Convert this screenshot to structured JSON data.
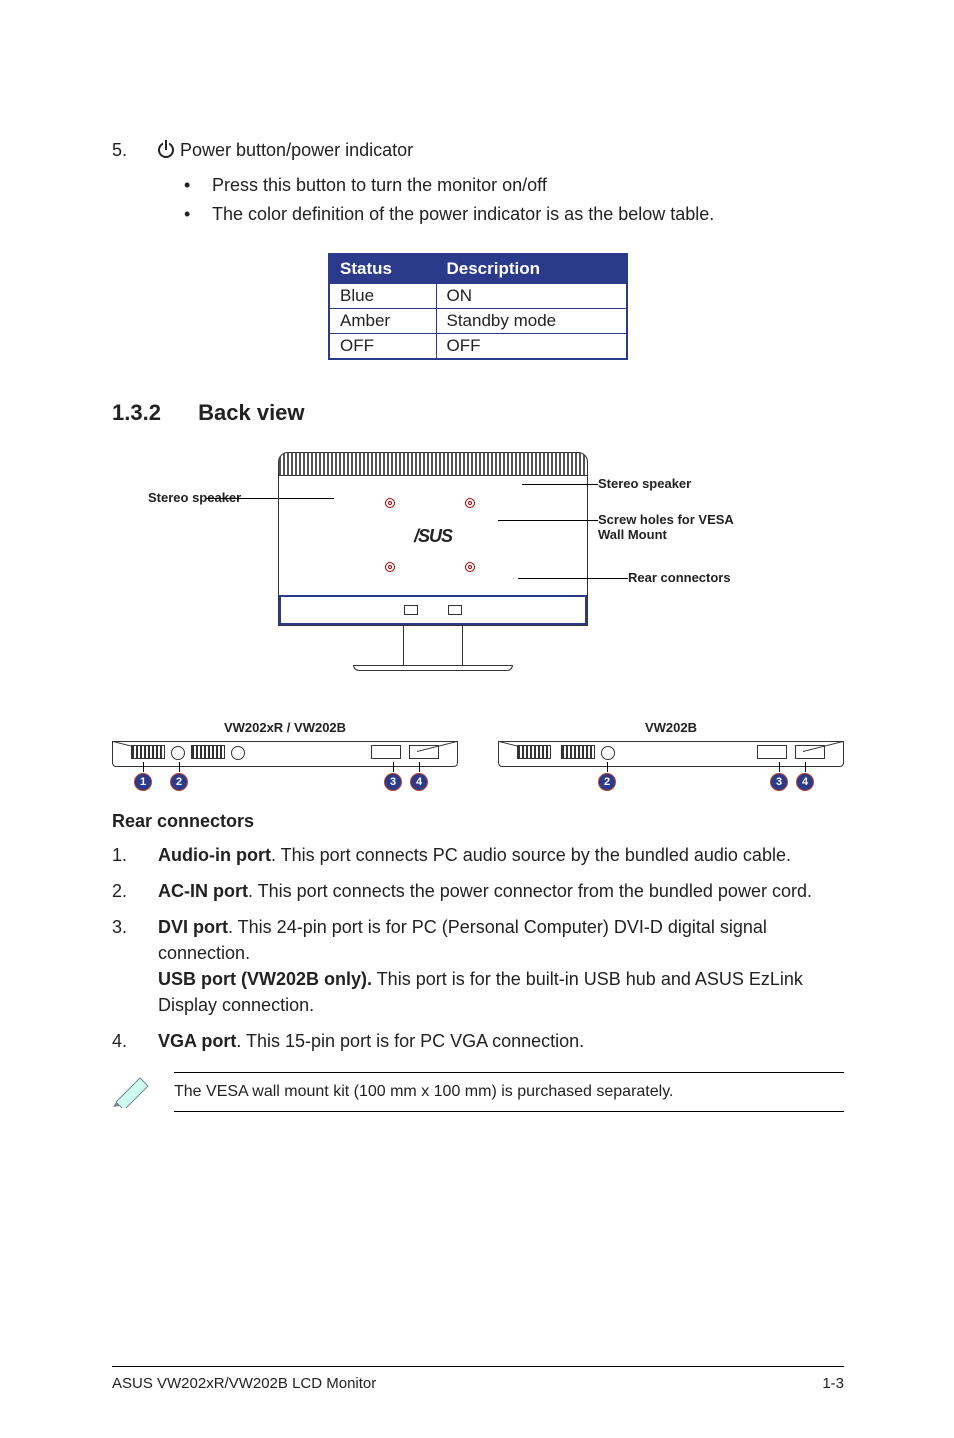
{
  "item5": {
    "num": "5.",
    "label": "Power button/power indicator",
    "bullets": [
      "Press this button to turn the monitor on/off",
      "The color definition of the power indicator is as the below table."
    ]
  },
  "status_table": {
    "headers": {
      "status": "Status",
      "description": "Description"
    },
    "rows": [
      {
        "status": "Blue",
        "desc": "ON"
      },
      {
        "status": "Amber",
        "desc": "Standby mode"
      },
      {
        "status": "OFF",
        "desc": "OFF"
      }
    ]
  },
  "section": {
    "num": "1.3.2",
    "title": "Back view"
  },
  "callouts": {
    "stereo_speaker": "Stereo speaker",
    "screw_holes": "Screw holes for VESA Wall Mount",
    "rear_connectors": "Rear connectors",
    "asus": "/SUS"
  },
  "panels": {
    "left_title": "VW202xR / VW202B",
    "right_title": "VW202B",
    "markers": {
      "m1": "1",
      "m2": "2",
      "m3": "3",
      "m4": "4"
    }
  },
  "rear_connectors_heading": "Rear connectors",
  "rc_items": [
    {
      "bold": "Audio-in port",
      "text": ". This port connects PC audio source by the bundled audio cable."
    },
    {
      "bold": "AC-IN port",
      "text": ". This port connects the power connector from the bundled power cord."
    },
    {
      "bold": "DVI port",
      "text": ". This 24-pin port is for PC (Personal Computer) DVI-D digital signal connection.",
      "bold2": "USB port (VW202B only).",
      "text2": " This port is for the built-in USB hub and ASUS EzLink Display connection."
    },
    {
      "bold": "VGA port",
      "text": ". This 15-pin port is for PC VGA connection."
    }
  ],
  "note": "The VESA wall mount kit (100 mm x 100 mm) is purchased separately.",
  "footer": {
    "left": "ASUS VW202xR/VW202B LCD Monitor",
    "right": "1-3"
  }
}
